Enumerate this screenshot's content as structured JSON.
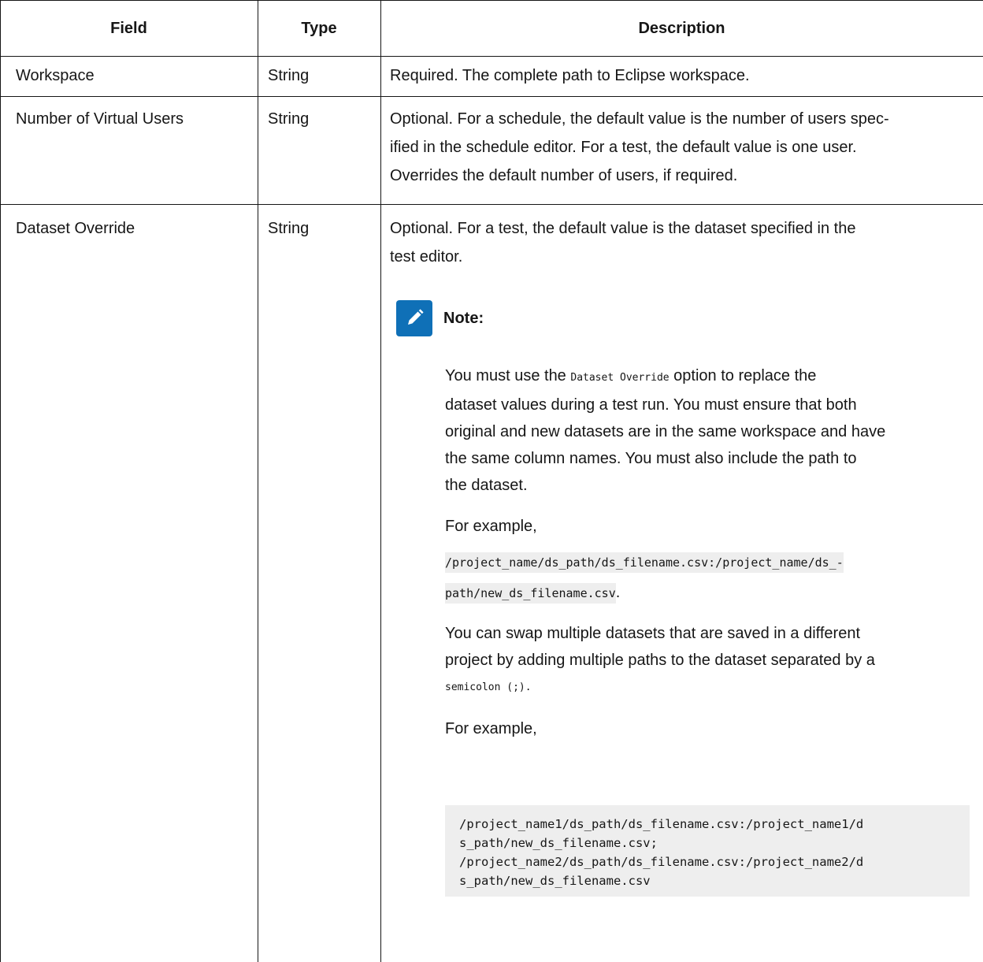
{
  "table": {
    "headers": {
      "field": "Field",
      "type": "Type",
      "description": "Description"
    },
    "rows": [
      {
        "field": "Workspace",
        "type": "String",
        "description": "Required. The complete path to Eclipse workspace."
      },
      {
        "field": "Number of Virtual Users",
        "type": "String",
        "description_lines": [
          "Optional. For a schedule, the default value is the number of users spec-",
          "ified in the schedule editor. For a test, the default value is one user.",
          "Overrides the default number of users, if required."
        ]
      },
      {
        "field": "Dataset Override",
        "type": "String",
        "description_lines": [
          "Optional. For a test, the default value is the dataset specified in the",
          "test editor."
        ],
        "note": {
          "label": "Note:",
          "icon": "pencil-note-icon",
          "p1_before": "You must use the ",
          "p1_code": "Dataset Override",
          "p1_after": " option to replace the",
          "p1_lines_rest": [
            "dataset values during a test run. You must ensure that both",
            "original and new datasets are in the same workspace and have",
            "the same column names. You must also include the path to",
            "the dataset."
          ],
          "example_label_1": "For example,",
          "example_code_1_line1": "/project_name/ds_path/ds_filename.csv:/project_name/ds_-",
          "example_code_1_line2": "path/new_ds_filename.csv",
          "example_code_1_suffix": ".",
          "p2_line1": "You can swap multiple datasets that are saved in a different",
          "p2_line2": "project by adding multiple paths to the dataset separated by a",
          "p2_code": "semicolon (;).",
          "example_label_2": "For example,",
          "example_code_2": "/project_name1/ds_path/ds_filename.csv:/project_name1/d\ns_path/new_ds_filename.csv;\n/project_name2/ds_path/ds_filename.csv:/project_name2/d\ns_path/new_ds_filename.csv"
        }
      }
    ]
  }
}
